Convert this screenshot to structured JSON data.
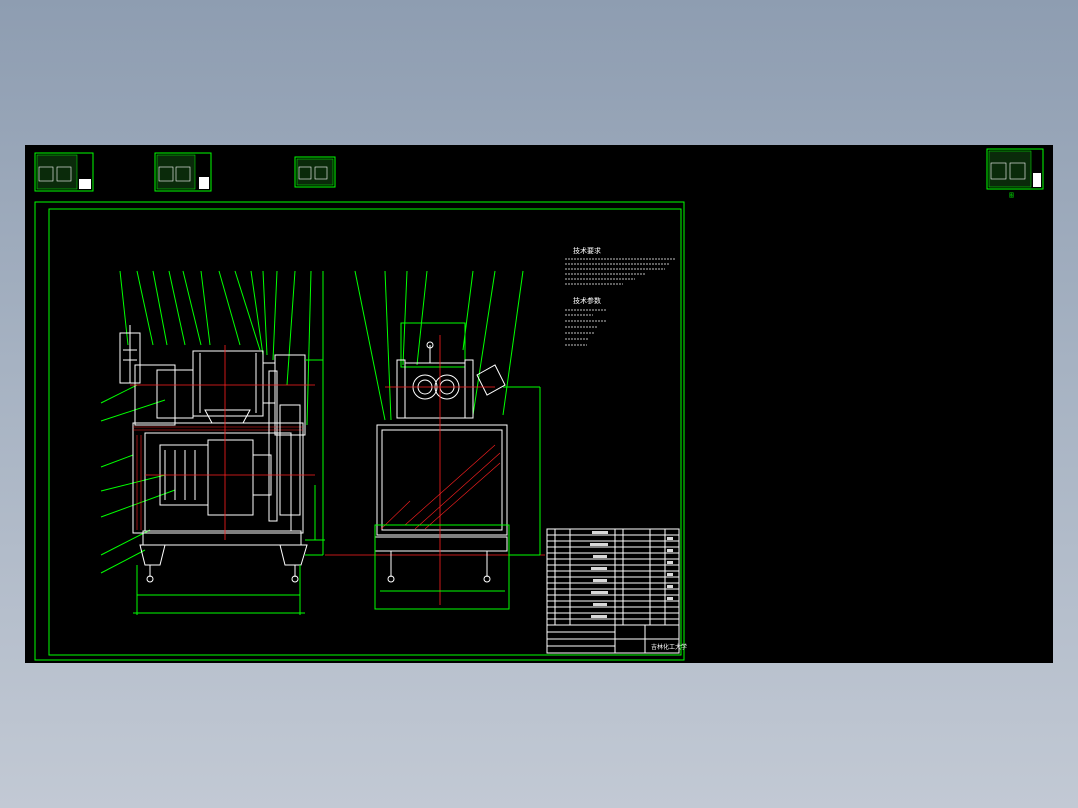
{
  "colors": {
    "background_top": "#8e9db1",
    "model_space": "#000000",
    "frame": "#00ff00",
    "geometry": "#ffffff",
    "centerline": "#ff2020"
  },
  "notes": {
    "tech_req_title": "技术要求",
    "tech_param_title": "技术参数"
  },
  "title_block": {
    "school": "吉林化工大学"
  },
  "thumbnail_label": "图"
}
